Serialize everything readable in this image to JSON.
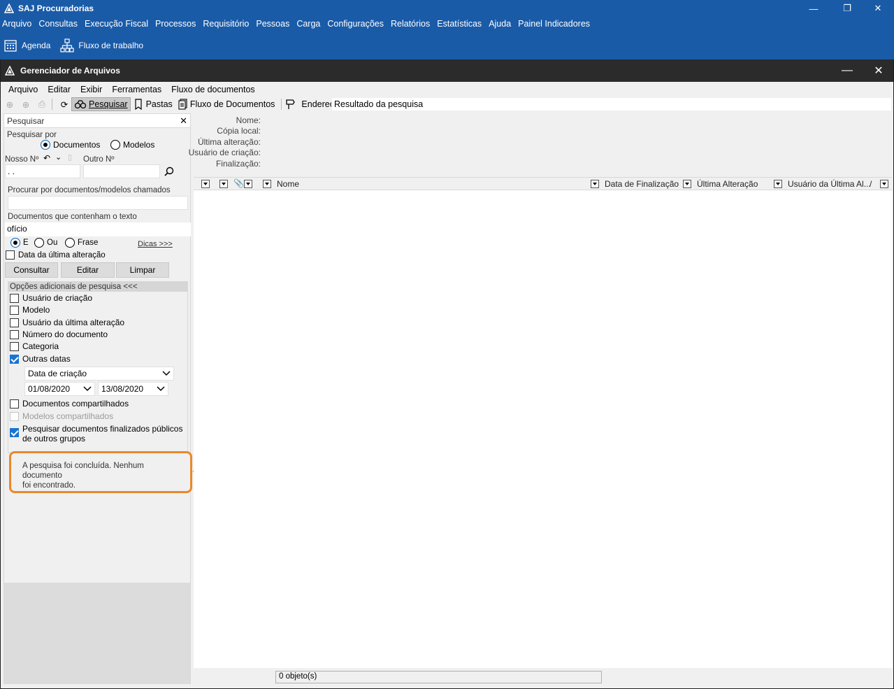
{
  "app": {
    "title": "SAJ Procuradorias",
    "menu": [
      "Arquivo",
      "Consultas",
      "Execução Fiscal",
      "Processos",
      "Requisitório",
      "Pessoas",
      "Carga",
      "Configurações",
      "Relatórios",
      "Estatísticas",
      "Ajuda",
      "Painel Indicadores"
    ],
    "toolbar": {
      "agenda": "Agenda",
      "workflow": "Fluxo de trabalho"
    }
  },
  "child": {
    "title": "Gerenciador de Arquivos",
    "menu": [
      "Arquivo",
      "Editar",
      "Exibir",
      "Ferramentas",
      "Fluxo de documentos"
    ],
    "toolbar": {
      "search": "Pesquisar",
      "folders": "Pastas",
      "doc_flow": "Fluxo de Documentos",
      "address_label": "Endereço",
      "address_value": "Resultado da pesquisa"
    }
  },
  "search_panel": {
    "title": "Pesquisar",
    "search_by_label": "Pesquisar por",
    "radio_documents": "Documentos",
    "radio_models": "Modelos",
    "our_number_label": "Nosso Nº",
    "our_number_value": ". .",
    "other_number_label": "Outro Nº",
    "name_search_label": "Procurar por documentos/modelos chamados",
    "name_search_value": "",
    "text_search_label": "Documentos que contenham o texto",
    "text_search_value": "ofício",
    "op_and": "E",
    "op_or": "Ou",
    "op_phrase": "Frase",
    "tips_link": "Dicas >>>",
    "last_change_date_label": "Data da última alteração",
    "btn_consult": "Consultar",
    "btn_edit": "Editar",
    "btn_clear": "Limpar",
    "extra_options_header": "Opções adicionais de pesquisa <<<",
    "options": {
      "creator_user": "Usuário de criação",
      "model": "Modelo",
      "last_change_user": "Usuário da última alteração",
      "doc_number": "Número do documento",
      "category": "Categoria",
      "other_dates": "Outras datas",
      "date_type": "Data de criação",
      "date_from": "01/08/2020",
      "date_to": "13/08/2020",
      "shared_docs": "Documentos compartilhados",
      "shared_models": "Modelos compartilhados",
      "public_finalized_line1": "Pesquisar documentos finalizados públicos",
      "public_finalized_line2": "de outros grupos"
    },
    "result_message_line1": "A pesquisa foi concluída. Nenhum documento",
    "result_message_line2": "foi encontrado."
  },
  "info_panel": {
    "name": "Nome:",
    "local_copy": "Cópia local:",
    "last_change": "Última alteração:",
    "creator_user": "Usuário de criação:",
    "finalization": "Finalização:"
  },
  "grid": {
    "columns": [
      "Nome",
      "Data de Finalização",
      "Última Alteração",
      "Usuário da Última Al...",
      "/"
    ]
  },
  "status": {
    "count": "0 objeto(s)"
  },
  "colors": {
    "app_blue": "#1a5ba8",
    "child_title": "#2b2b2b",
    "annotation": "#e8892b",
    "checked": "#1874d2"
  }
}
